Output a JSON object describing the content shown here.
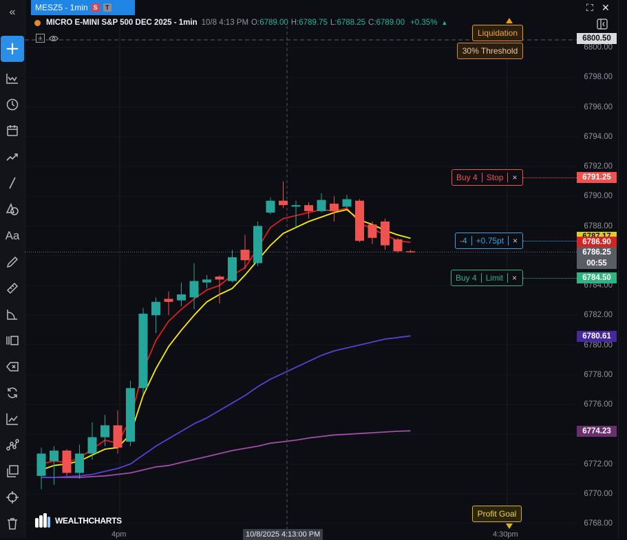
{
  "tab": {
    "title": "MESZ5 - 1min",
    "badge_s": "S",
    "badge_t": "T"
  },
  "symbol": {
    "title": "MICRO E-MINI S&P 500 DEC 2025 - 1min",
    "datetime": "10/8 4:13 PM",
    "o_label": "O:",
    "o": "6789.00",
    "h_label": "H:",
    "h": "6789.75",
    "l_label": "L:",
    "l": "6788.25",
    "c_label": "C:",
    "c": "6789.00",
    "change": "+0.35%"
  },
  "y_axis": {
    "ticks": [
      "6800.00",
      "6798.00",
      "6796.00",
      "6794.00",
      "6792.00",
      "6790.00",
      "6788.00",
      "6786.00",
      "6784.00",
      "6782.00",
      "6780.00",
      "6778.00",
      "6776.00",
      "6774.00",
      "6772.00",
      "6770.00",
      "6768.00"
    ]
  },
  "x_axis": {
    "labels": [
      "4pm",
      "10/8/2025 4:13:00 PM",
      "4:30pm"
    ]
  },
  "price_tags": {
    "top": "6800.50",
    "stop": "6791.25",
    "ema_yellow": "6787.17",
    "ema_red": "6786.90",
    "last": "6786.25",
    "countdown": "00:55",
    "limit": "6784.50",
    "ma_blue": "6780.61",
    "ma_purple": "6774.23"
  },
  "orders": {
    "stop": {
      "label": "Buy 4",
      "type": "Stop",
      "close": "×"
    },
    "position": {
      "label": "-4",
      "pnl": "+0.75pt",
      "close": "×"
    },
    "limit": {
      "label": "Buy 4",
      "type": "Limit",
      "close": "×"
    }
  },
  "markers": {
    "liquidation": "Liquidation",
    "threshold": "30% Threshold",
    "profit_goal": "Profit Goal"
  },
  "branding": {
    "name": "WEALTHCHARTS"
  },
  "colors": {
    "up": "#26a69a",
    "down": "#ef5350",
    "accent": "#1f86e6",
    "ema_fast": "#ffee00",
    "ema_red": "#e01e1e",
    "ma_blue": "#5b3fd4",
    "ma_purple": "#a04ea8"
  },
  "chart_data": {
    "type": "candlestick",
    "candles": [
      {
        "o": 6771.2,
        "h": 6773.1,
        "l": 6770.3,
        "c": 6772.7
      },
      {
        "o": 6772.2,
        "h": 6773.2,
        "l": 6770.6,
        "c": 6772.9
      },
      {
        "o": 6772.9,
        "h": 6773.0,
        "l": 6771.2,
        "c": 6771.4
      },
      {
        "o": 6771.4,
        "h": 6773.3,
        "l": 6771.0,
        "c": 6772.7
      },
      {
        "o": 6772.7,
        "h": 6774.8,
        "l": 6772.3,
        "c": 6773.8
      },
      {
        "o": 6773.8,
        "h": 6775.3,
        "l": 6773.2,
        "c": 6774.6
      },
      {
        "o": 6774.6,
        "h": 6775.6,
        "l": 6772.7,
        "c": 6773.1
      },
      {
        "o": 6773.5,
        "h": 6777.6,
        "l": 6773.2,
        "c": 6777.1
      },
      {
        "o": 6777.1,
        "h": 6782.5,
        "l": 6776.7,
        "c": 6782.1
      },
      {
        "o": 6782.0,
        "h": 6783.2,
        "l": 6780.8,
        "c": 6782.9
      },
      {
        "o": 6783.1,
        "h": 6783.6,
        "l": 6782.0,
        "c": 6782.9
      },
      {
        "o": 6783.0,
        "h": 6784.2,
        "l": 6782.6,
        "c": 6783.4
      },
      {
        "o": 6783.2,
        "h": 6785.5,
        "l": 6782.4,
        "c": 6784.3
      },
      {
        "o": 6784.2,
        "h": 6784.7,
        "l": 6783.8,
        "c": 6784.4
      },
      {
        "o": 6784.6,
        "h": 6784.7,
        "l": 6782.8,
        "c": 6784.4
      },
      {
        "o": 6784.3,
        "h": 6786.4,
        "l": 6784.2,
        "c": 6785.9
      },
      {
        "o": 6786.4,
        "h": 6787.4,
        "l": 6785.1,
        "c": 6785.7
      },
      {
        "o": 6785.5,
        "h": 6788.3,
        "l": 6785.3,
        "c": 6788.0
      },
      {
        "o": 6788.9,
        "h": 6789.9,
        "l": 6788.8,
        "c": 6789.7
      },
      {
        "o": 6789.7,
        "h": 6791.0,
        "l": 6789.2,
        "c": 6789.4
      },
      {
        "o": 6789.3,
        "h": 6789.7,
        "l": 6787.9,
        "c": 6789.4
      },
      {
        "o": 6789.4,
        "h": 6789.6,
        "l": 6788.5,
        "c": 6789.0
      },
      {
        "o": 6789.0,
        "h": 6790.2,
        "l": 6788.9,
        "c": 6789.75
      },
      {
        "o": 6789.5,
        "h": 6790.0,
        "l": 6788.3,
        "c": 6789.0
      },
      {
        "o": 6789.3,
        "h": 6790.1,
        "l": 6789.2,
        "c": 6789.8
      },
      {
        "o": 6789.7,
        "h": 6789.8,
        "l": 6786.9,
        "c": 6787.0
      },
      {
        "o": 6788.1,
        "h": 6788.3,
        "l": 6786.8,
        "c": 6787.2
      },
      {
        "o": 6788.3,
        "h": 6788.5,
        "l": 6786.4,
        "c": 6786.7
      },
      {
        "o": 6787.1,
        "h": 6787.2,
        "l": 6786.2,
        "c": 6786.3
      },
      {
        "o": 6786.3,
        "h": 6786.4,
        "l": 6786.2,
        "c": 6786.25
      }
    ],
    "ema_yellow": [
      6771.6,
      6771.9,
      6772.0,
      6772.2,
      6772.6,
      6773.0,
      6773.1,
      6774.0,
      6776.6,
      6778.4,
      6779.9,
      6781.0,
      6782.0,
      6782.9,
      6783.4,
      6783.8,
      6784.7,
      6785.7,
      6786.7,
      6787.5,
      6787.9,
      6788.3,
      6788.6,
      6788.9,
      6789.1,
      6788.4,
      6788.1,
      6787.7,
      6787.4,
      6787.17
    ],
    "ema_red": [
      6772.0,
      6772.2,
      6772.1,
      6772.4,
      6773.0,
      6773.6,
      6773.4,
      6775.0,
      6778.3,
      6780.3,
      6781.6,
      6782.4,
      6783.1,
      6783.7,
      6784.0,
      6784.7,
      6785.2,
      6786.5,
      6787.9,
      6788.5,
      6788.7,
      6788.9,
      6789.1,
      6789.0,
      6789.2,
      6788.2,
      6787.8,
      6787.4,
      6787.0,
      6786.9
    ],
    "ma_blue": [
      6771.1,
      6771.1,
      6771.15,
      6771.2,
      6771.3,
      6771.5,
      6771.7,
      6772.0,
      6772.6,
      6773.2,
      6773.7,
      6774.2,
      6774.7,
      6775.1,
      6775.6,
      6776.1,
      6776.6,
      6777.2,
      6777.7,
      6778.1,
      6778.5,
      6778.9,
      6779.3,
      6779.6,
      6779.8,
      6780.0,
      6780.2,
      6780.4,
      6780.5,
      6780.61
    ],
    "ma_purple": [
      6771.1,
      6771.1,
      6771.1,
      6771.1,
      6771.15,
      6771.2,
      6771.3,
      6771.4,
      6771.6,
      6771.8,
      6771.9,
      6772.1,
      6772.3,
      6772.5,
      6772.7,
      6772.9,
      6773.05,
      6773.2,
      6773.4,
      6773.5,
      6773.6,
      6773.75,
      6773.85,
      6773.95,
      6774.0,
      6774.05,
      6774.1,
      6774.15,
      6774.2,
      6774.23
    ]
  }
}
